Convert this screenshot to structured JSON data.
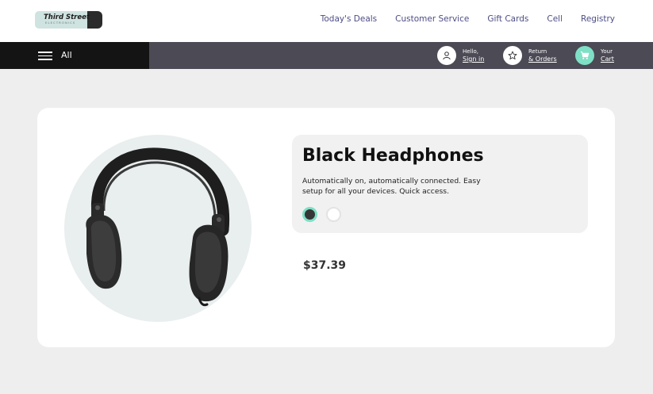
{
  "brand": {
    "name": "Third Street",
    "tagline": "ELECTRONICS"
  },
  "nav": {
    "links": [
      "Today's Deals",
      "Customer Service",
      "Gift Cards",
      "Cell",
      "Registry"
    ]
  },
  "subnav": {
    "all_label": "All",
    "account": {
      "greeting": "Hello,",
      "action": "Sign in"
    },
    "orders": {
      "line1": "Return",
      "line2": "& Orders"
    },
    "cart": {
      "line1": "Your",
      "line2": "Cart"
    }
  },
  "product": {
    "title": "Black Headphones",
    "description": "Automatically on, automatically connected. Easy setup for all your devices. Quick access.",
    "colors": [
      {
        "name": "black",
        "hex": "#363636",
        "selected": true
      },
      {
        "name": "white",
        "hex": "#ffffff",
        "selected": false
      }
    ],
    "price": "$37.39"
  },
  "theme": {
    "accent": "#7ee0c6",
    "nav_text": "#4d4d86",
    "dark_bar": "#4b4a55"
  }
}
